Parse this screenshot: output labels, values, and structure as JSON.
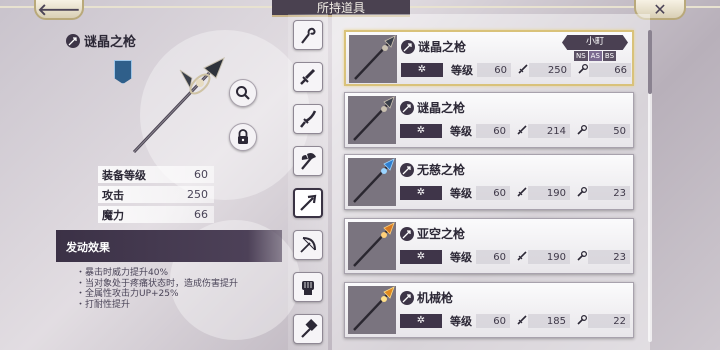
{
  "header": {
    "back_symbol": "🡐",
    "title": "所持道具",
    "close_symbol": "✕"
  },
  "detail": {
    "name": "谜晶之枪",
    "stats": [
      {
        "label": "装备等级",
        "value": "60"
      },
      {
        "label": "攻击",
        "value": "250"
      },
      {
        "label": "魔力",
        "value": "66"
      }
    ],
    "effect_title": "发动效果",
    "effects": [
      "・暴击时威力提升40%",
      "・当对象处于疼痛状态时，造成伤害提升",
      "・全属性攻击力UP+25%",
      "・打耐性提升"
    ]
  },
  "category_tabs": [
    {
      "icon": "staff-icon"
    },
    {
      "icon": "sword-icon"
    },
    {
      "icon": "katana-icon"
    },
    {
      "icon": "axe-icon"
    },
    {
      "icon": "spear-icon"
    },
    {
      "icon": "bow-icon"
    },
    {
      "icon": "gauntlet-icon"
    },
    {
      "icon": "hammer-icon"
    }
  ],
  "active_tab": 4,
  "list_labels": {
    "level": "等级",
    "star": "✲"
  },
  "items": [
    {
      "name": "谜晶之枪",
      "level": "60",
      "attack": "250",
      "magic": "66",
      "selected": true,
      "owner": "小町",
      "owner_tags": [
        "NS",
        "AS",
        "BS"
      ],
      "blade": "#3a3f4a",
      "accent": "#c9c0b0"
    },
    {
      "name": "谜晶之枪",
      "level": "60",
      "attack": "214",
      "magic": "50",
      "selected": false,
      "blade": "#3a3f4a",
      "accent": "#c9c0b0"
    },
    {
      "name": "无慈之枪",
      "level": "60",
      "attack": "190",
      "magic": "23",
      "selected": false,
      "blade": "#2f7fd0",
      "accent": "#9bd4ff"
    },
    {
      "name": "亚空之枪",
      "level": "60",
      "attack": "190",
      "magic": "23",
      "selected": false,
      "blade": "#d87a20",
      "accent": "#ffd07a"
    },
    {
      "name": "机械枪",
      "level": "60",
      "attack": "185",
      "magic": "22",
      "selected": false,
      "blade": "#e08a20",
      "accent": "#ffe08a"
    }
  ],
  "colors": {
    "panel_dark": "#3b3146",
    "highlight": "#d9c27a"
  }
}
